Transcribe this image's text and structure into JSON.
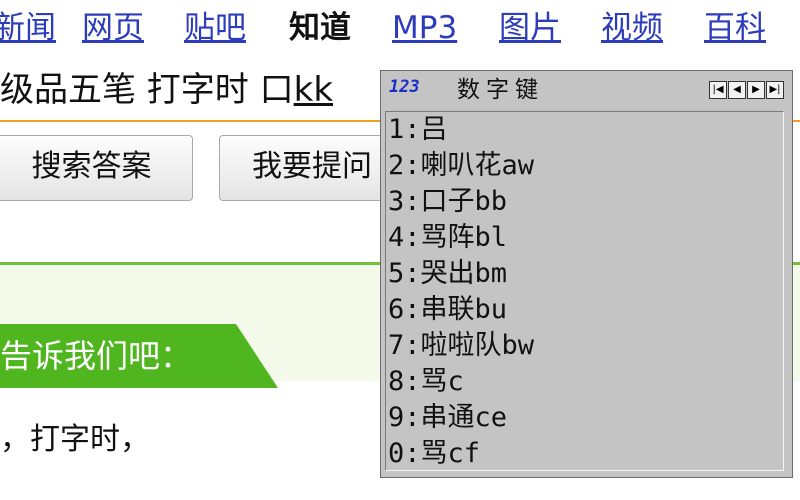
{
  "nav": {
    "items": [
      "新闻",
      "网页",
      "贴吧",
      "知道",
      "MP3",
      "图片",
      "视频",
      "百科"
    ],
    "active": "知道"
  },
  "search": {
    "text_before": "级品五笔 打字时 口",
    "typed": "kk"
  },
  "buttons": {
    "search_answer": "搜索答案",
    "ask_question": "我要提问"
  },
  "banner": {
    "text": "告诉我们吧："
  },
  "content": {
    "text": "，打字时，"
  },
  "ime": {
    "logo": "123",
    "title": "数字键",
    "nav_icons": [
      "first-page-icon",
      "prev-page-icon",
      "next-page-icon",
      "last-page-icon"
    ],
    "candidates": [
      "1:吕",
      "2:喇叭花aw",
      "3:口子bb",
      "4:骂阵bl",
      "5:哭出bm",
      "6:串联bu",
      "7:啦啦队bw",
      "8:骂c",
      "9:串通ce",
      "0:骂cf"
    ]
  },
  "colors": {
    "link": "#2d3cba",
    "accent": "#f0a020",
    "green": "#50b620",
    "ime_bg": "#c4c4c4"
  }
}
